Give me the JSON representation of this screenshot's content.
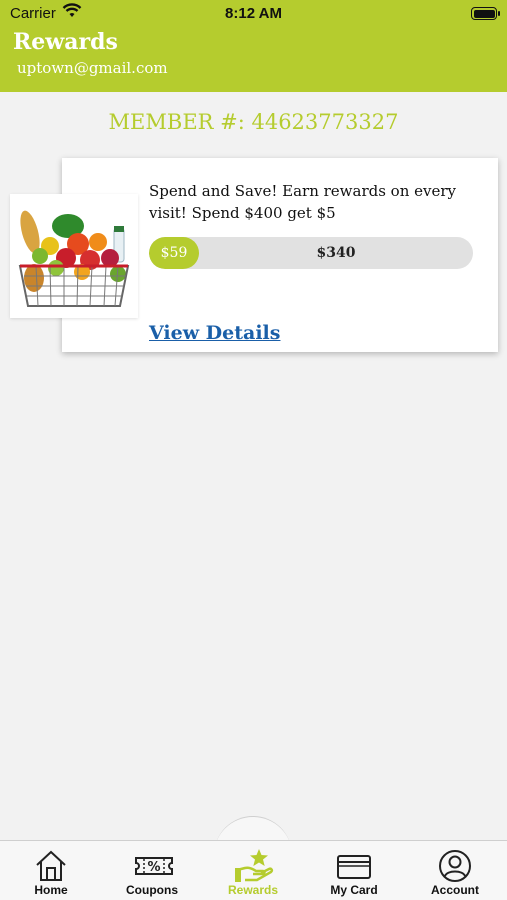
{
  "status_bar": {
    "carrier": "Carrier",
    "time": "8:12 AM"
  },
  "header": {
    "title": "Rewards",
    "email": "uptown@gmail.com"
  },
  "member": {
    "text": "MEMBER #: 44623773327"
  },
  "reward_card": {
    "offer_text": "Spend and Save! Earn rewards on every visit! Spend $400 get $5",
    "progress": {
      "earned_label": "$59",
      "remaining_label": "$340",
      "fraction": 0.15
    },
    "details_link": "View Details",
    "image_icon": "grocery-basket-image"
  },
  "tabs": [
    {
      "label": "Home",
      "icon": "home-icon",
      "active": false
    },
    {
      "label": "Coupons",
      "icon": "coupon-icon",
      "active": false
    },
    {
      "label": "Rewards",
      "icon": "rewards-hand-star-icon",
      "active": true
    },
    {
      "label": "My Card",
      "icon": "card-icon",
      "active": false
    },
    {
      "label": "Account",
      "icon": "account-icon",
      "active": false
    }
  ],
  "colors": {
    "brand": "#b5cc2e",
    "link": "#1a5fa8"
  }
}
